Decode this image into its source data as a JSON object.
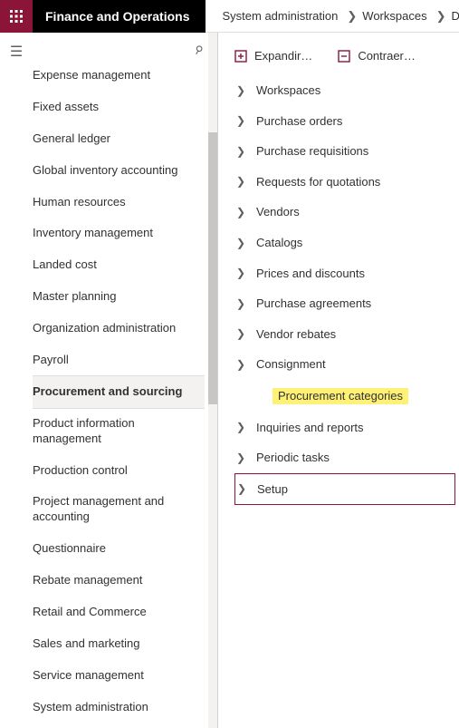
{
  "header": {
    "brand": "Finance and Operations",
    "breadcrumb": [
      "System administration",
      "Workspaces",
      "Data"
    ]
  },
  "actions": {
    "expand": "Expandir…",
    "collapse": "Contraer…"
  },
  "sidebar": {
    "items": [
      {
        "label": "Expense management"
      },
      {
        "label": "Fixed assets"
      },
      {
        "label": "General ledger"
      },
      {
        "label": "Global inventory accounting"
      },
      {
        "label": "Human resources"
      },
      {
        "label": "Inventory management"
      },
      {
        "label": "Landed cost"
      },
      {
        "label": "Master planning"
      },
      {
        "label": "Organization administration"
      },
      {
        "label": "Payroll"
      },
      {
        "label": "Procurement and sourcing",
        "selected": true
      },
      {
        "label": "Product information management"
      },
      {
        "label": "Production control"
      },
      {
        "label": "Project management and accounting"
      },
      {
        "label": "Questionnaire"
      },
      {
        "label": "Rebate management"
      },
      {
        "label": "Retail and Commerce"
      },
      {
        "label": "Sales and marketing"
      },
      {
        "label": "Service management"
      },
      {
        "label": "System administration"
      }
    ]
  },
  "tree": {
    "items": [
      {
        "label": "Workspaces"
      },
      {
        "label": "Purchase orders"
      },
      {
        "label": "Purchase requisitions"
      },
      {
        "label": "Requests for quotations"
      },
      {
        "label": "Vendors"
      },
      {
        "label": "Catalogs"
      },
      {
        "label": "Prices and discounts"
      },
      {
        "label": "Purchase agreements"
      },
      {
        "label": "Vendor rebates"
      },
      {
        "label": "Consignment"
      },
      {
        "label": "Procurement categories",
        "highlighted": true
      },
      {
        "label": "Inquiries and reports"
      },
      {
        "label": "Periodic tasks"
      },
      {
        "label": "Setup",
        "boxed": true
      }
    ]
  }
}
